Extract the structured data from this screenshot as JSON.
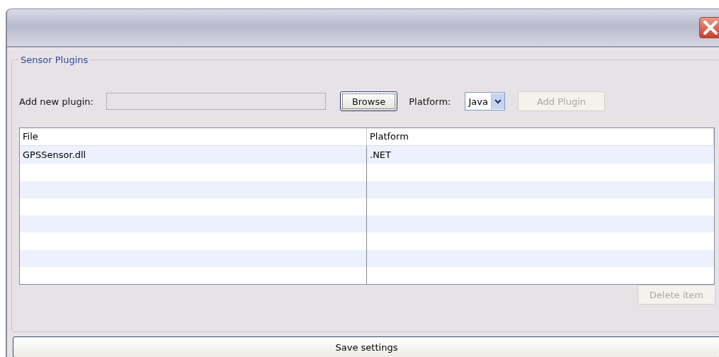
{
  "group": {
    "title": "Sensor Plugins"
  },
  "add_row": {
    "label": "Add new plugin:",
    "browse_button": "Browse",
    "platform_label": "Platform:",
    "platform_value": "Java",
    "add_button": {
      "label": "Add Plugin",
      "disabled": true
    }
  },
  "table": {
    "columns": [
      "File",
      "Platform"
    ],
    "rows": [
      {
        "file": "GPSSensor.dll",
        "platform": ".NET"
      }
    ]
  },
  "delete_button": {
    "label": "Delete item",
    "disabled": true
  },
  "save_button": "Save settings"
}
